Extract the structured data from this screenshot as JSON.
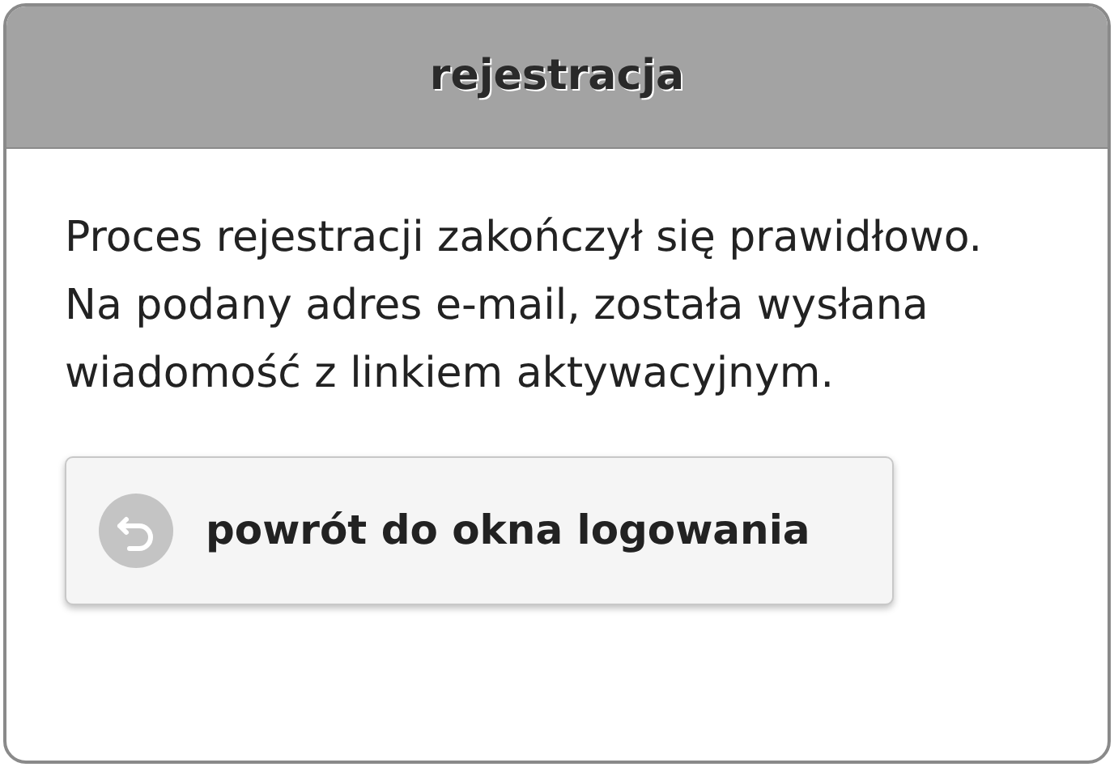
{
  "dialog": {
    "title": "rejestracja",
    "message": "Proces rejestracji zakończył się prawidłowo. Na podany adres e-mail, została wysłana wiadomość z linkiem aktywacyjnym.",
    "button": {
      "label": "powrót do okna logowania"
    }
  }
}
